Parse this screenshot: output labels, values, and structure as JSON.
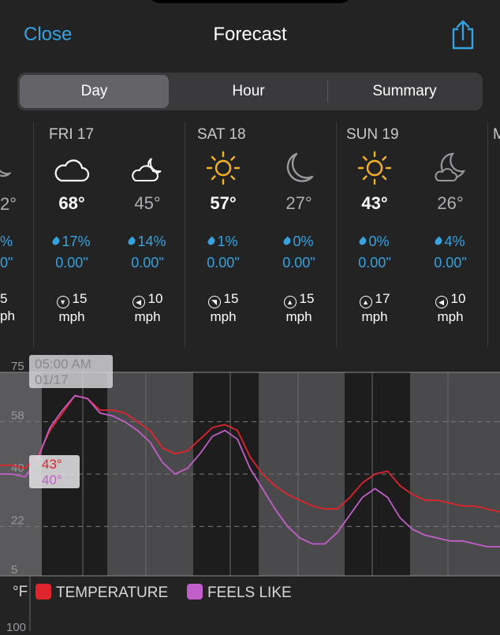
{
  "header": {
    "close_label": "Close",
    "title": "Forecast"
  },
  "tabs": [
    {
      "label": "Day",
      "active": true
    },
    {
      "label": "Hour",
      "active": false
    },
    {
      "label": "Summary",
      "active": false
    }
  ],
  "partial_left": {
    "temp": "2°",
    "precip_pct": "%",
    "precip_amt": "0\"",
    "wind_speed": "5",
    "wind_unit": "ph"
  },
  "days": [
    {
      "name": "FRI 17",
      "day": {
        "icon": "cloud-icon",
        "temp": "68°",
        "precip_pct": "17%",
        "precip_amt": "0.00\"",
        "wind_speed": "15",
        "wind_unit": "mph"
      },
      "night": {
        "icon": "partly-cloudy-night-icon",
        "temp": "45°",
        "precip_pct": "14%",
        "precip_amt": "0.00\"",
        "wind_speed": "10",
        "wind_unit": "mph"
      }
    },
    {
      "name": "SAT 18",
      "day": {
        "icon": "sun-icon",
        "temp": "57°",
        "precip_pct": "1%",
        "precip_amt": "0.00\"",
        "wind_speed": "15",
        "wind_unit": "mph"
      },
      "night": {
        "icon": "moon-icon",
        "temp": "27°",
        "precip_pct": "0%",
        "precip_amt": "0.00\"",
        "wind_speed": "15",
        "wind_unit": "mph"
      }
    },
    {
      "name": "SUN 19",
      "day": {
        "icon": "sun-icon",
        "temp": "43°",
        "precip_pct": "0%",
        "precip_amt": "0.00\"",
        "wind_speed": "17",
        "wind_unit": "mph"
      },
      "night": {
        "icon": "partly-cloudy-night-icon",
        "temp": "26°",
        "precip_pct": "4%",
        "precip_amt": "0.00\"",
        "wind_speed": "10",
        "wind_unit": "mph"
      }
    }
  ],
  "partial_right_day": "M",
  "chart_data": {
    "type": "line",
    "y_ticks": [
      "75",
      "58",
      "40",
      "22",
      "5"
    ],
    "ylim": [
      5,
      75
    ],
    "unit_label": "°F",
    "next_panel_tick": "100",
    "tooltip": {
      "time": "05:00 AM",
      "date": "01/17",
      "temperature": "43°",
      "feels_like": "40°"
    },
    "x": [
      0,
      1,
      2,
      3,
      4,
      5,
      6,
      7,
      8,
      9,
      10,
      11,
      12,
      13,
      14,
      15,
      16,
      17,
      18,
      19,
      20,
      21,
      22,
      23,
      24,
      25,
      26,
      27,
      28,
      29,
      30,
      31,
      32,
      33,
      34,
      35,
      36,
      37,
      38,
      39,
      40
    ],
    "series": [
      {
        "name": "TEMPERATURE",
        "color": "#e0242c",
        "values": [
          43,
          43,
          42,
          46,
          55,
          61,
          67,
          66,
          62,
          62,
          61,
          58,
          55,
          49,
          47,
          48,
          52,
          56,
          57,
          55,
          46,
          40,
          36,
          33,
          31,
          29,
          28,
          28,
          32,
          37,
          40,
          41,
          36,
          33,
          31,
          31,
          30,
          29,
          29,
          28,
          27
        ]
      },
      {
        "name": "FEELS LIKE",
        "color": "#c25ec9",
        "values": [
          40,
          40,
          39,
          45,
          56,
          62,
          67,
          66,
          61,
          60,
          58,
          55,
          51,
          44,
          40,
          42,
          47,
          53,
          55,
          52,
          42,
          35,
          28,
          22,
          18,
          16,
          16,
          20,
          26,
          32,
          35,
          32,
          25,
          21,
          19,
          18,
          17,
          17,
          16,
          15,
          15
        ]
      }
    ]
  }
}
